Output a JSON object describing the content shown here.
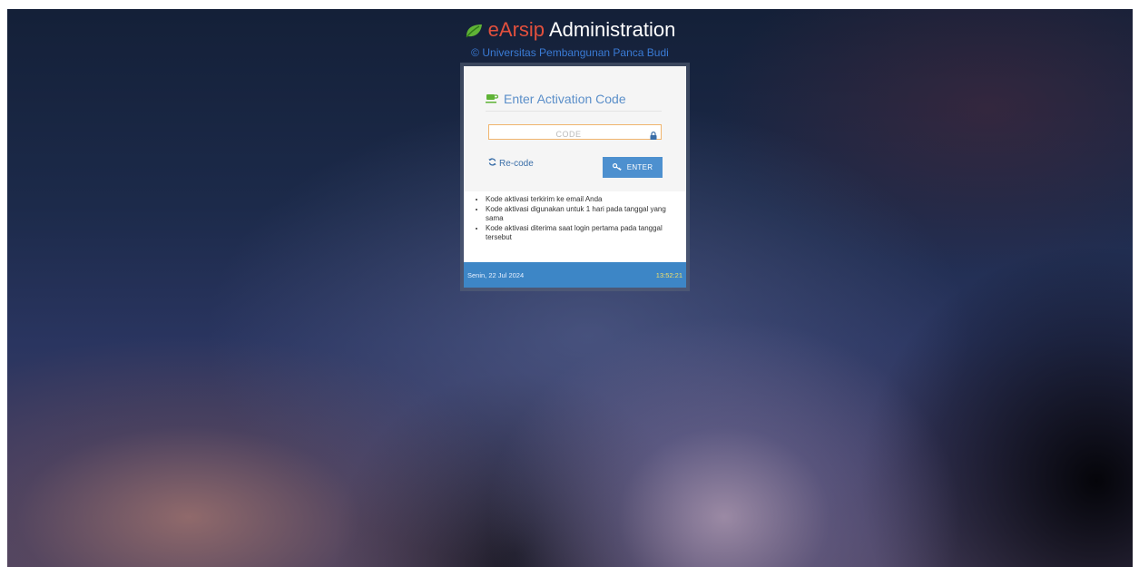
{
  "header": {
    "brand": "eArsip",
    "title_rest": "Administration",
    "subtitle": "© Universitas Pembangunan Panca Budi"
  },
  "card": {
    "title": "Enter Activation Code",
    "code_placeholder": "CODE",
    "code_value": "",
    "recode_label": "Re-code",
    "enter_label": "ENTER",
    "notes": [
      "Kode aktivasi terkirim ke email Anda",
      "Kode aktivasi digunakan untuk 1 hari pada tanggal yang sama",
      "Kode aktivasi diterima saat login pertama pada tanggal tersebut"
    ],
    "date": "Senin, 22 Jul 2024",
    "time": "13:52:21"
  },
  "colors": {
    "brand_red": "#e2503d",
    "link_blue": "#3a7bd5",
    "button_blue": "#4d90cf",
    "footer_blue": "#3d86c6",
    "time_yellow": "#f3e06a",
    "leaf_green": "#5fb336"
  },
  "icons": [
    "leaf-icon",
    "coffee-cup-icon",
    "lock-icon",
    "refresh-icon",
    "key-icon"
  ]
}
